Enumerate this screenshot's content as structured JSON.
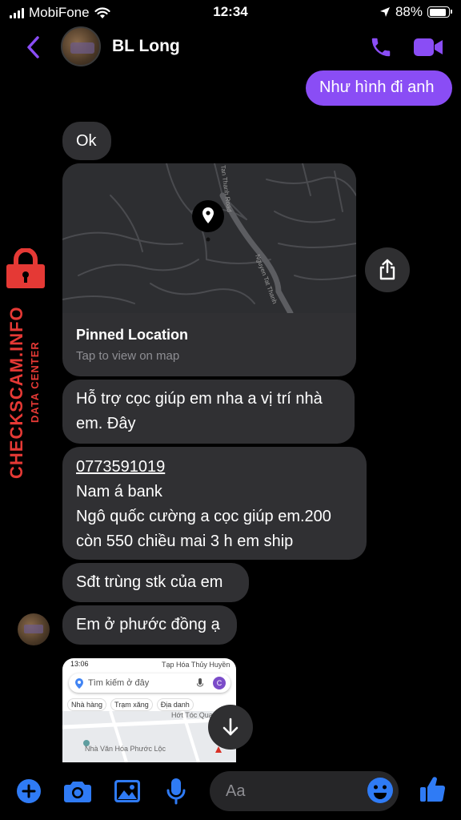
{
  "status_bar": {
    "carrier": "MobiFone",
    "time": "12:34",
    "battery": "88%",
    "battery_level": 0.88
  },
  "header": {
    "contact_name": "BL Long",
    "icons": {
      "back": "chevron-left-icon",
      "call": "phone-icon",
      "video": "video-camera-icon"
    },
    "accent_color": "#8a4df5"
  },
  "messages": {
    "sent_1": "Như hình đi anh",
    "ok": "Ok",
    "location": {
      "title": "Pinned Location",
      "subtitle": "Tap to view on map",
      "road_label_1": "Tan Thanh Road",
      "road_label_2": "Nguyen Tat Thanh"
    },
    "hotro": "Hỗ trợ cọc giúp em nha a vị trí nhà em. Đây",
    "long_lines": [
      "0773591019",
      "Nam á bank",
      "Ngô quốc cường a cọc giúp em.200",
      "còn 550 chiều mai 3 h em ship"
    ],
    "sdt": "Sđt trùng stk của em",
    "em_o": "Em ở phước đồng ạ",
    "screenshot": {
      "status_time": "13:06",
      "top_label": "Tạp Hóa Thủy Huyền",
      "search_placeholder": "Tìm kiếm ở đây",
      "avatar_letter": "C",
      "chips": [
        "Nhà hàng",
        "Trạm xăng",
        "Địa danh"
      ],
      "map_text_1": "Hớt Tóc Quang",
      "map_text_2": "Nhà Văn Hóa Phước Lộc"
    }
  },
  "composer": {
    "placeholder": "Aa",
    "icons": [
      "plus-icon",
      "camera-icon",
      "image-icon",
      "microphone-icon",
      "emoji-icon",
      "thumbs-up-icon"
    ]
  },
  "watermark": {
    "main": "CHECKSCAM.INFO",
    "sub": "DATA CENTER",
    "color": "#e53935"
  }
}
